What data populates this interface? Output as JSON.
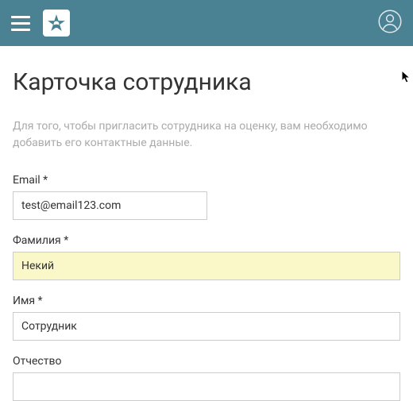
{
  "header": {
    "brand_color": "#4a8193"
  },
  "page": {
    "title": "Карточка сотрудника",
    "description": "Для того, чтобы пригласить сотрудника на оценку, вам необходимо добавить его контактные данные."
  },
  "form": {
    "email": {
      "label": "Email *",
      "value": "test@email123.com"
    },
    "lastname": {
      "label": "Фамилия *",
      "value": "Некий"
    },
    "firstname": {
      "label": "Имя *",
      "value": "Сотрудник"
    },
    "middlename": {
      "label": "Отчество",
      "value": ""
    }
  }
}
